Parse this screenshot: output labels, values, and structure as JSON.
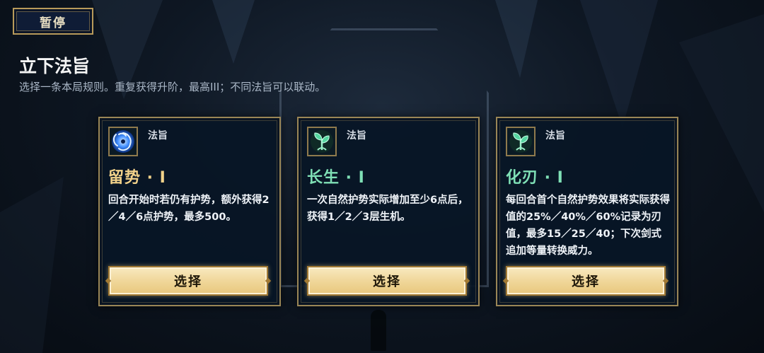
{
  "pause_label": "暂停",
  "title": "立下法旨",
  "subtitle": "选择一条本局规则。重复获得升阶，最高III；不同法旨可以联动。",
  "colors": {
    "gold_border": "#9a8656",
    "name_gold": "#f2d28a",
    "name_green": "#7fe0b6"
  },
  "cards": [
    {
      "category": "法旨",
      "name": "留势 · I",
      "description": "回合开始时若仍有护势，额外获得2／4／6点护势，最多500。",
      "button_label": "选择",
      "icon": "blue-vortex-icon"
    },
    {
      "category": "法旨",
      "name": "长生 · I",
      "description": "一次自然护势实际增加至少6点后，获得1／2／3层生机。",
      "button_label": "选择",
      "icon": "green-sprout-icon"
    },
    {
      "category": "法旨",
      "name": "化刃 · I",
      "description": "每回合首个自然护势效果将实际获得值的25%／40%／60%记录为刃值，最多15／25／40；下次剑式追加等量转换威力。",
      "button_label": "选择",
      "icon": "green-sprout-icon"
    }
  ]
}
